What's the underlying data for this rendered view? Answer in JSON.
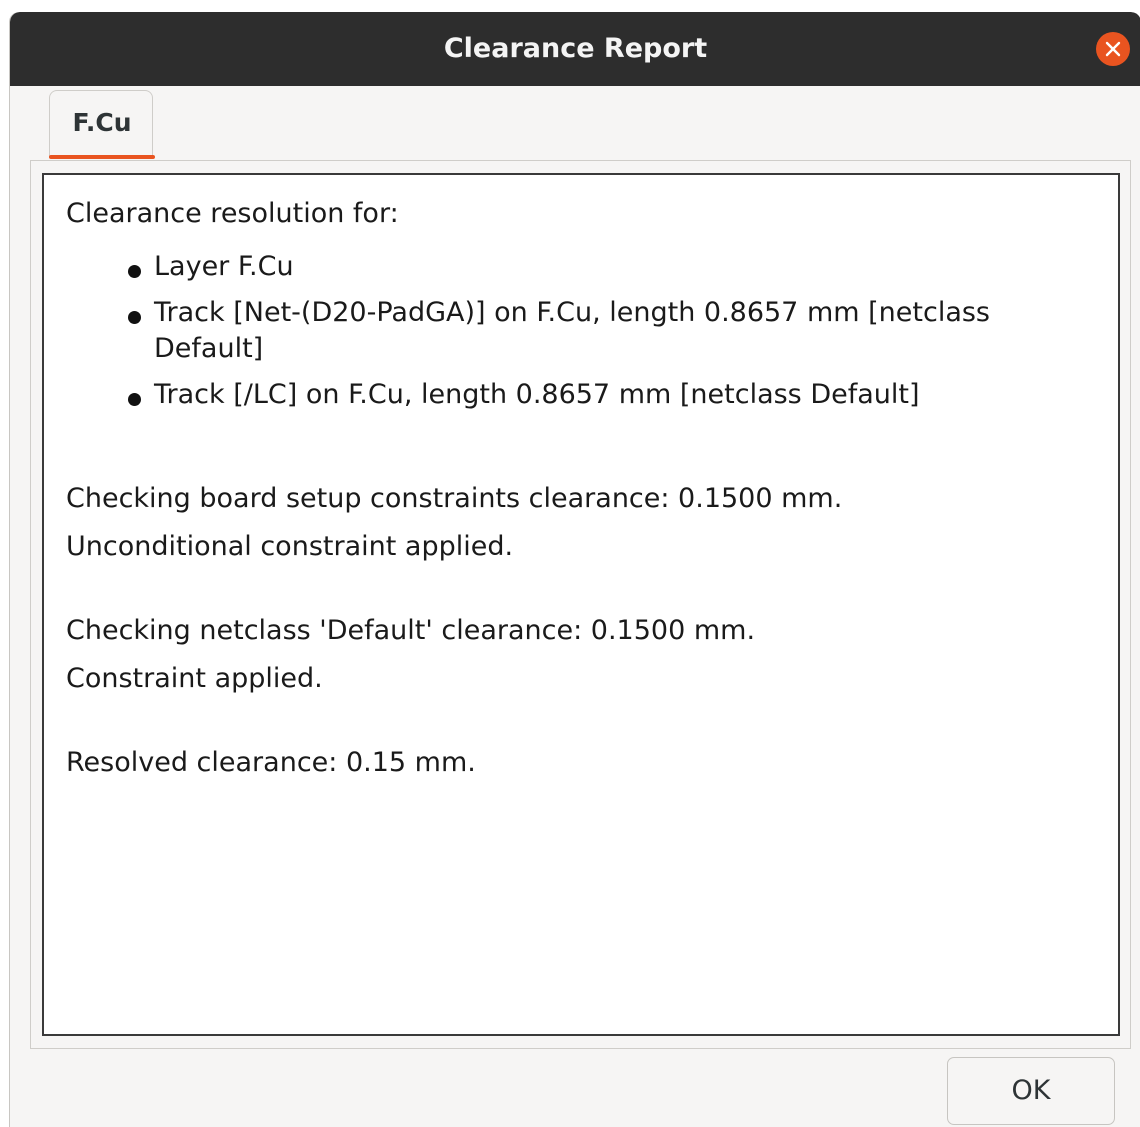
{
  "window": {
    "title": "Clearance Report",
    "close_icon": "close-icon"
  },
  "tabs": [
    {
      "label": "F.Cu",
      "active": true
    }
  ],
  "report": {
    "heading": "Clearance resolution for:",
    "items": [
      "Layer F.Cu",
      "Track [Net-(D20-PadGA)] on F.Cu, length 0.8657 mm [netclass Default]",
      "Track [/LC] on F.Cu, length 0.8657 mm [netclass Default]"
    ],
    "line1": "Checking board setup constraints clearance: 0.1500 mm.",
    "line2": "Unconditional constraint applied.",
    "line3": "Checking netclass 'Default' clearance: 0.1500 mm.",
    "line4": "Constraint applied.",
    "line5": "Resolved clearance: 0.15 mm."
  },
  "buttons": {
    "ok_label": "OK"
  },
  "colors": {
    "accent": "#e95420",
    "titlebar": "#2d2d2d",
    "background": "#f6f5f4"
  }
}
